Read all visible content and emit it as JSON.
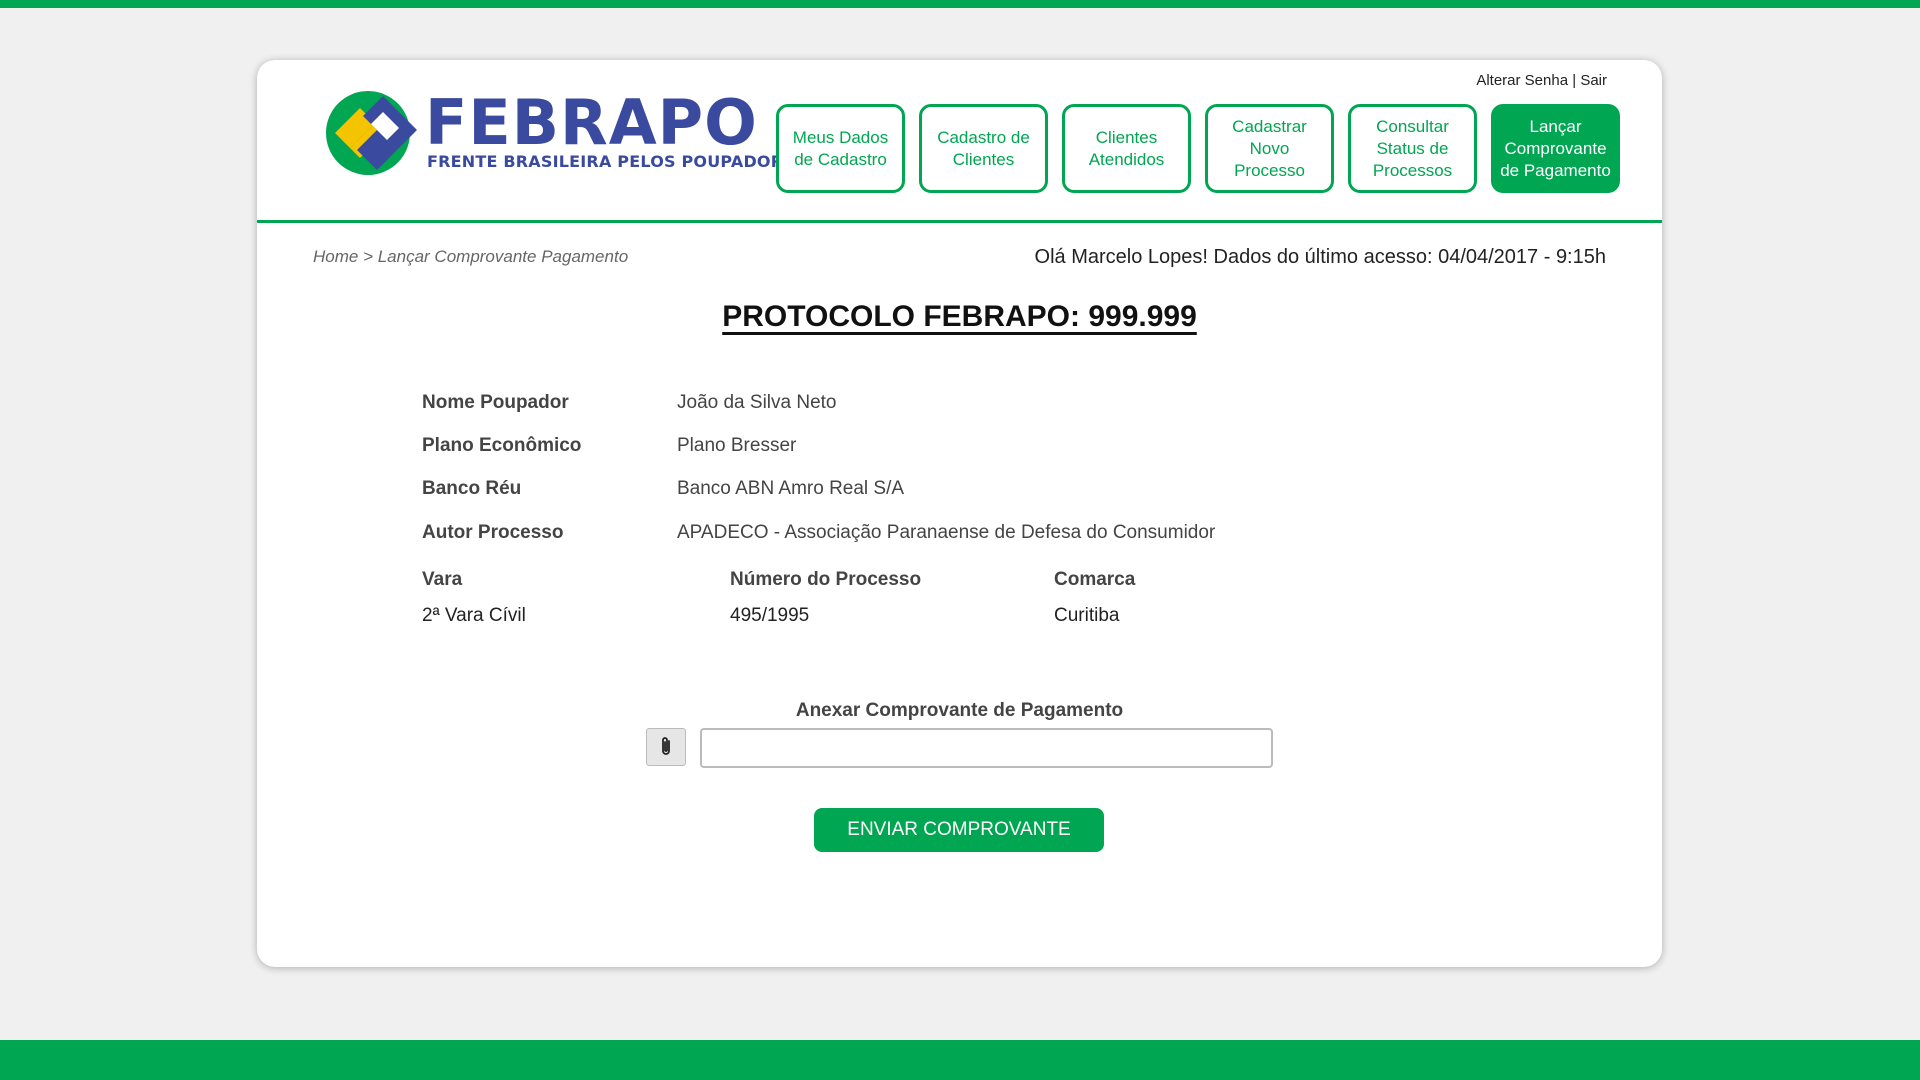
{
  "header": {
    "links": {
      "change_password": "Alterar Senha",
      "separator": "|",
      "logout": "Sair"
    },
    "logo": {
      "name": "FEBRAPO",
      "tagline": "FRENTE BRASILEIRA PELOS POUPADORES"
    },
    "nav": [
      {
        "label": "Meus Dados de Cadastro",
        "active": false
      },
      {
        "label": "Cadastro de Clientes",
        "active": false
      },
      {
        "label": "Clientes Atendidos",
        "active": false
      },
      {
        "label": "Cadastrar Novo Processo",
        "active": false
      },
      {
        "label": "Consultar Status de Processos",
        "active": false
      },
      {
        "label": "Lançar Comprovante de Pagamento",
        "active": true
      }
    ]
  },
  "breadcrumb": "Home > Lançar Comprovante Pagamento",
  "greeting": "Olá Marcelo Lopes! Dados do último acesso: 04/04/2017 - 9:15h",
  "protocol": "PROTOCOLO FEBRAPO: 999.999",
  "fields": [
    {
      "label": "Nome Poupador",
      "value": "João da Silva Neto"
    },
    {
      "label": "Plano Econômico",
      "value": "Plano Bresser"
    },
    {
      "label": "Banco Réu",
      "value": "Banco ABN Amro Real S/A"
    },
    {
      "label": "Autor Processo",
      "value": "APADECO - Associação Paranaense de Defesa do Consumidor"
    }
  ],
  "details": {
    "vara": {
      "label": "Vara",
      "value": "2ª Vara Cívil"
    },
    "numero": {
      "label": "Número do Processo",
      "value": "495/1995"
    },
    "comarca": {
      "label": "Comarca",
      "value": "Curitiba"
    }
  },
  "attach": {
    "label": "Anexar Comprovante de Pagamento",
    "value": "",
    "icon": "paperclip-icon"
  },
  "submit_label": "ENVIAR COMPROVANTE",
  "colors": {
    "accent": "#00a651",
    "brand_blue": "#3a4a9f",
    "brand_yellow": "#f5c400"
  }
}
